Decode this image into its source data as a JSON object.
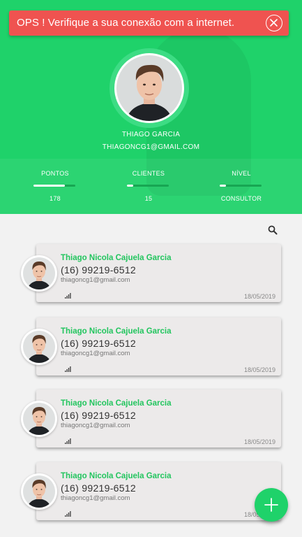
{
  "alert": {
    "message": "OPS ! Verifique a sua conexão com a  internet.",
    "close_icon": "close-circle-icon",
    "color": "#ef5350"
  },
  "profile": {
    "name": "THIAGO GARCIA",
    "email": "THIAGONCG1@GMAIL.COM",
    "avatar_icon": "person-photo"
  },
  "stats": [
    {
      "label": "PONTOS",
      "value": "178",
      "progress": 0.75
    },
    {
      "label": "CLIENTES",
      "value": "15",
      "progress": 0.15
    },
    {
      "label": "NÍVEL",
      "value": "CONSULTOR",
      "progress": 0.15
    }
  ],
  "search": {
    "icon": "search-icon"
  },
  "clients": [
    {
      "name": "Thiago Nicola Cajuela Garcia",
      "phone": "(16) 99219-6512",
      "email": "thiagoncg1@gmail.com",
      "date": "18/05/2019",
      "signal_icon": "signal-bars-icon"
    },
    {
      "name": "Thiago Nicola Cajuela Garcia",
      "phone": "(16) 99219-6512",
      "email": "thiagoncg1@gmail.com",
      "date": "18/05/2019",
      "signal_icon": "signal-bars-icon"
    },
    {
      "name": "Thiago Nicola Cajuela Garcia",
      "phone": "(16) 99219-6512",
      "email": "thiagoncg1@gmail.com",
      "date": "18/05/2019",
      "signal_icon": "signal-bars-icon"
    },
    {
      "name": "Thiago Nicola Cajuela Garcia",
      "phone": "(16) 99219-6512",
      "email": "thiagoncg1@gmail.com",
      "date": "18/05/2019",
      "signal_icon": "signal-bars-icon"
    }
  ],
  "fab": {
    "icon": "plus-icon"
  },
  "colors": {
    "primary": "#1fd26a",
    "accent_text": "#22c55e",
    "alert": "#ef5350",
    "card": "#eceaea"
  }
}
